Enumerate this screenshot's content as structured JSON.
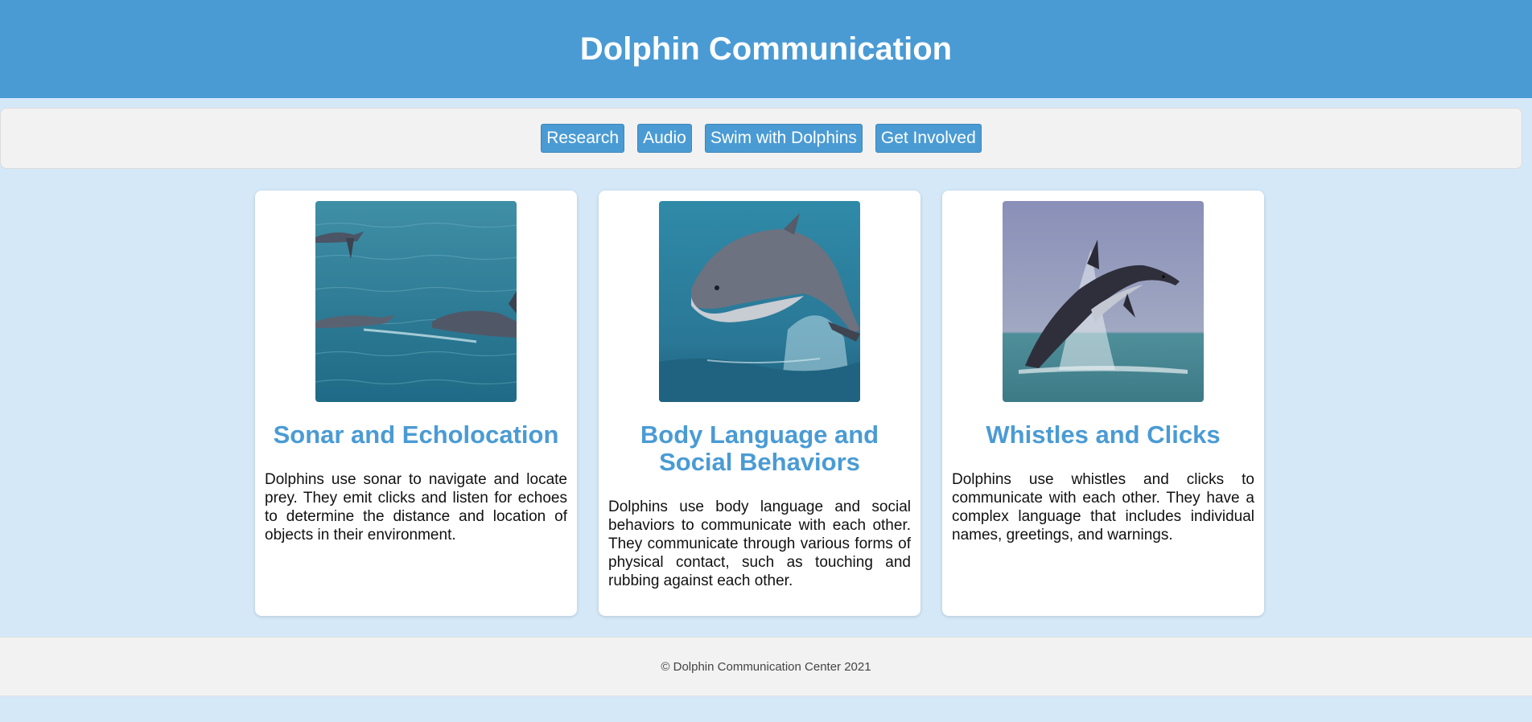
{
  "header": {
    "title": "Dolphin Communication"
  },
  "nav": {
    "items": [
      {
        "label": "Research"
      },
      {
        "label": "Audio"
      },
      {
        "label": "Swim with Dolphins"
      },
      {
        "label": "Get Involved"
      }
    ]
  },
  "cards": [
    {
      "image": "dolphins-swimming-image",
      "title": "Sonar and Echolocation",
      "text": "Dolphins use sonar to navigate and locate prey. They emit clicks and listen for echoes to determine the distance and location of objects in their environment."
    },
    {
      "image": "dolphin-leaping-closeup-image",
      "title": "Body Language and Social Behaviors",
      "text": "Dolphins use body language and social behaviors to communicate with each other. They communicate through various forms of physical contact, such as touching and rubbing against each other."
    },
    {
      "image": "dolphin-jumping-splash-image",
      "title": "Whistles and Clicks",
      "text": "Dolphins use whistles and clicks to communicate with each other. They have a complex language that includes individual names, greetings, and warnings."
    }
  ],
  "footer": {
    "copyright": "© Dolphin Communication Center 2021"
  },
  "colors": {
    "accent": "#4a9bd4",
    "page_background": "#d4e8f8",
    "panel_background": "#f2f2f2"
  }
}
